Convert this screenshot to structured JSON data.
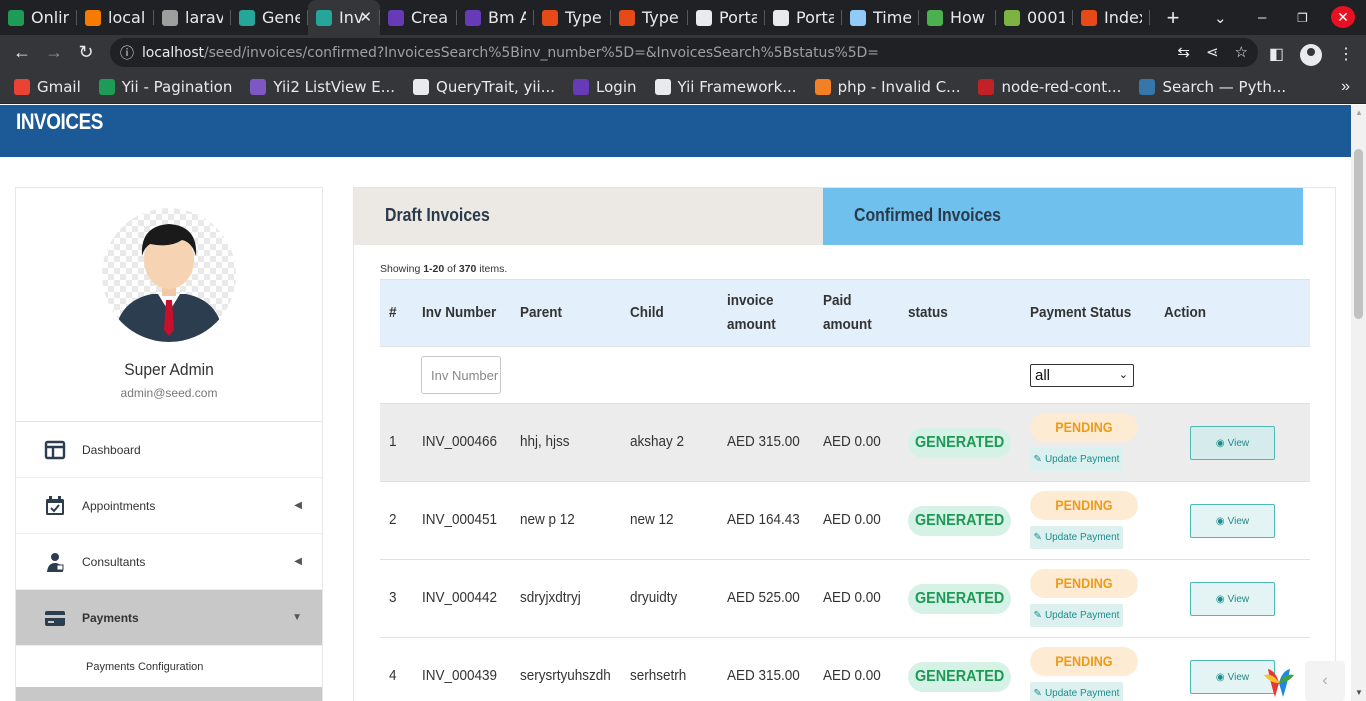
{
  "browser": {
    "tabs": [
      {
        "title": "Onlin",
        "color": "#1e9b57"
      },
      {
        "title": "local",
        "color": "#f57c00"
      },
      {
        "title": "larav",
        "color": "#9e9e9e"
      },
      {
        "title": "Gene",
        "color": "#26a69a"
      },
      {
        "title": "Inv",
        "color": "#26a69a",
        "active": true
      },
      {
        "title": "Crea",
        "color": "#673ab7"
      },
      {
        "title": "Bm A",
        "color": "#673ab7"
      },
      {
        "title": "Type",
        "color": "#e64a19"
      },
      {
        "title": "Type",
        "color": "#e64a19"
      },
      {
        "title": "Porta",
        "color": "#e8eaed"
      },
      {
        "title": "Porta",
        "color": "#e8eaed"
      },
      {
        "title": "Time",
        "color": "#90caf9"
      },
      {
        "title": "How",
        "color": "#4caf50"
      },
      {
        "title": "0001",
        "color": "#7cb342"
      },
      {
        "title": "Index",
        "color": "#e64a19"
      }
    ],
    "url_host": "localhost",
    "url_path": "/seed/invoices/confirmed?InvoicesSearch%5Binv_number%5D=&InvoicesSearch%5Bstatus%5D=",
    "bookmarks": [
      {
        "label": "Gmail",
        "color": "#ea4335"
      },
      {
        "label": "Yii - Pagination",
        "color": "#1e9b57"
      },
      {
        "label": "Yii2 ListView E...",
        "color": "#7e57c2"
      },
      {
        "label": "QueryTrait, yii...",
        "color": "#e8eaed"
      },
      {
        "label": "Login",
        "color": "#673ab7"
      },
      {
        "label": "Yii Framework...",
        "color": "#e8eaed"
      },
      {
        "label": "php - Invalid C...",
        "color": "#f48024"
      },
      {
        "label": "node-red-cont...",
        "color": "#c12127"
      },
      {
        "label": "Search — Pyth...",
        "color": "#3776ab"
      }
    ]
  },
  "header": {
    "title": "INVOICES",
    "color": "#1b5a96"
  },
  "sidebar": {
    "user_name": "Super Admin",
    "user_email": "admin@seed.com",
    "items": [
      {
        "label": "Dashboard",
        "icon": "dashboard-icon"
      },
      {
        "label": "Appointments",
        "icon": "calendar-icon"
      },
      {
        "label": "Consultants",
        "icon": "consultant-icon"
      },
      {
        "label": "Payments",
        "icon": "credit-card-icon"
      }
    ],
    "subitem": "Payments Configuration"
  },
  "main": {
    "tab_draft": "Draft Invoices",
    "tab_confirmed": "Confirmed Invoices",
    "summary_prefix": "Showing",
    "summary_range": "1-20",
    "summary_of": "of",
    "summary_total": "370",
    "summary_suffix": "items.",
    "columns": [
      "#",
      "Inv Number",
      "Parent",
      "Child",
      "invoice amount",
      "Paid amount",
      "status",
      "Payment Status",
      "Action"
    ],
    "filter_placeholder": "Inv Number",
    "filter_select_value": "all",
    "rows": [
      {
        "num": "1",
        "inv": "INV_000466",
        "parent": "hhj, hjss",
        "child": "akshay 2",
        "amount": "AED 315.00",
        "paid": "AED 0.00",
        "status": "GENERATED",
        "payment": "PENDING"
      },
      {
        "num": "2",
        "inv": "INV_000451",
        "parent": "new p 12",
        "child": "new 12",
        "amount": "AED 164.43",
        "paid": "AED 0.00",
        "status": "GENERATED",
        "payment": "PENDING"
      },
      {
        "num": "3",
        "inv": "INV_000442",
        "parent": "sdryjxdtryj",
        "child": "dryuidty",
        "amount": "AED 525.00",
        "paid": "AED 0.00",
        "status": "GENERATED",
        "payment": "PENDING"
      },
      {
        "num": "4",
        "inv": "INV_000439",
        "parent": "serysrtyuhszdh",
        "child": "serhsetrh",
        "amount": "AED 315.00",
        "paid": "AED 0.00",
        "status": "GENERATED",
        "payment": "PENDING"
      }
    ],
    "update_label": "Update Payment",
    "view_label": "View"
  }
}
